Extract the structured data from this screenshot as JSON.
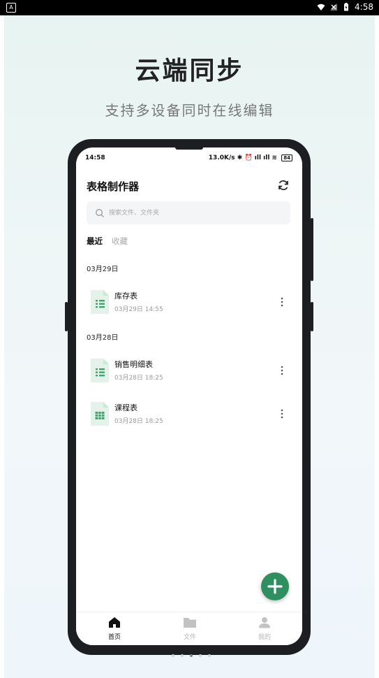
{
  "system_status": {
    "time": "4:58",
    "left_badge": "A"
  },
  "promo": {
    "headline": "云端同步",
    "subline": "支持多设备同时在线编辑"
  },
  "phone_status": {
    "time": "14:58",
    "net_speed": "13.0K/s",
    "battery": "84"
  },
  "app": {
    "title": "表格制作器",
    "search_placeholder": "搜索文件、文件夹",
    "tabs": [
      {
        "label": "最近",
        "active": true
      },
      {
        "label": "收藏",
        "active": false
      }
    ],
    "groups": [
      {
        "date": "03月29日",
        "files": [
          {
            "name": "库存表",
            "time": "03月29日 14:55",
            "icon": "sheet-list-icon"
          }
        ]
      },
      {
        "date": "03月28日",
        "files": [
          {
            "name": "销售明细表",
            "time": "03月28日 18:25",
            "icon": "sheet-list-icon"
          },
          {
            "name": "课程表",
            "time": "03月28日 18:25",
            "icon": "sheet-grid-icon"
          }
        ]
      }
    ],
    "bottom_nav": [
      {
        "label": "首页",
        "icon": "home-icon",
        "active": true
      },
      {
        "label": "文件",
        "icon": "folder-icon",
        "active": false
      },
      {
        "label": "我的",
        "icon": "profile-icon",
        "active": false
      }
    ]
  },
  "colors": {
    "accent": "#2f8f60",
    "file_icon": "#e3f3ea",
    "file_icon_mark": "#3aa76d"
  },
  "pager": {
    "count": 5,
    "active_index": 2
  }
}
